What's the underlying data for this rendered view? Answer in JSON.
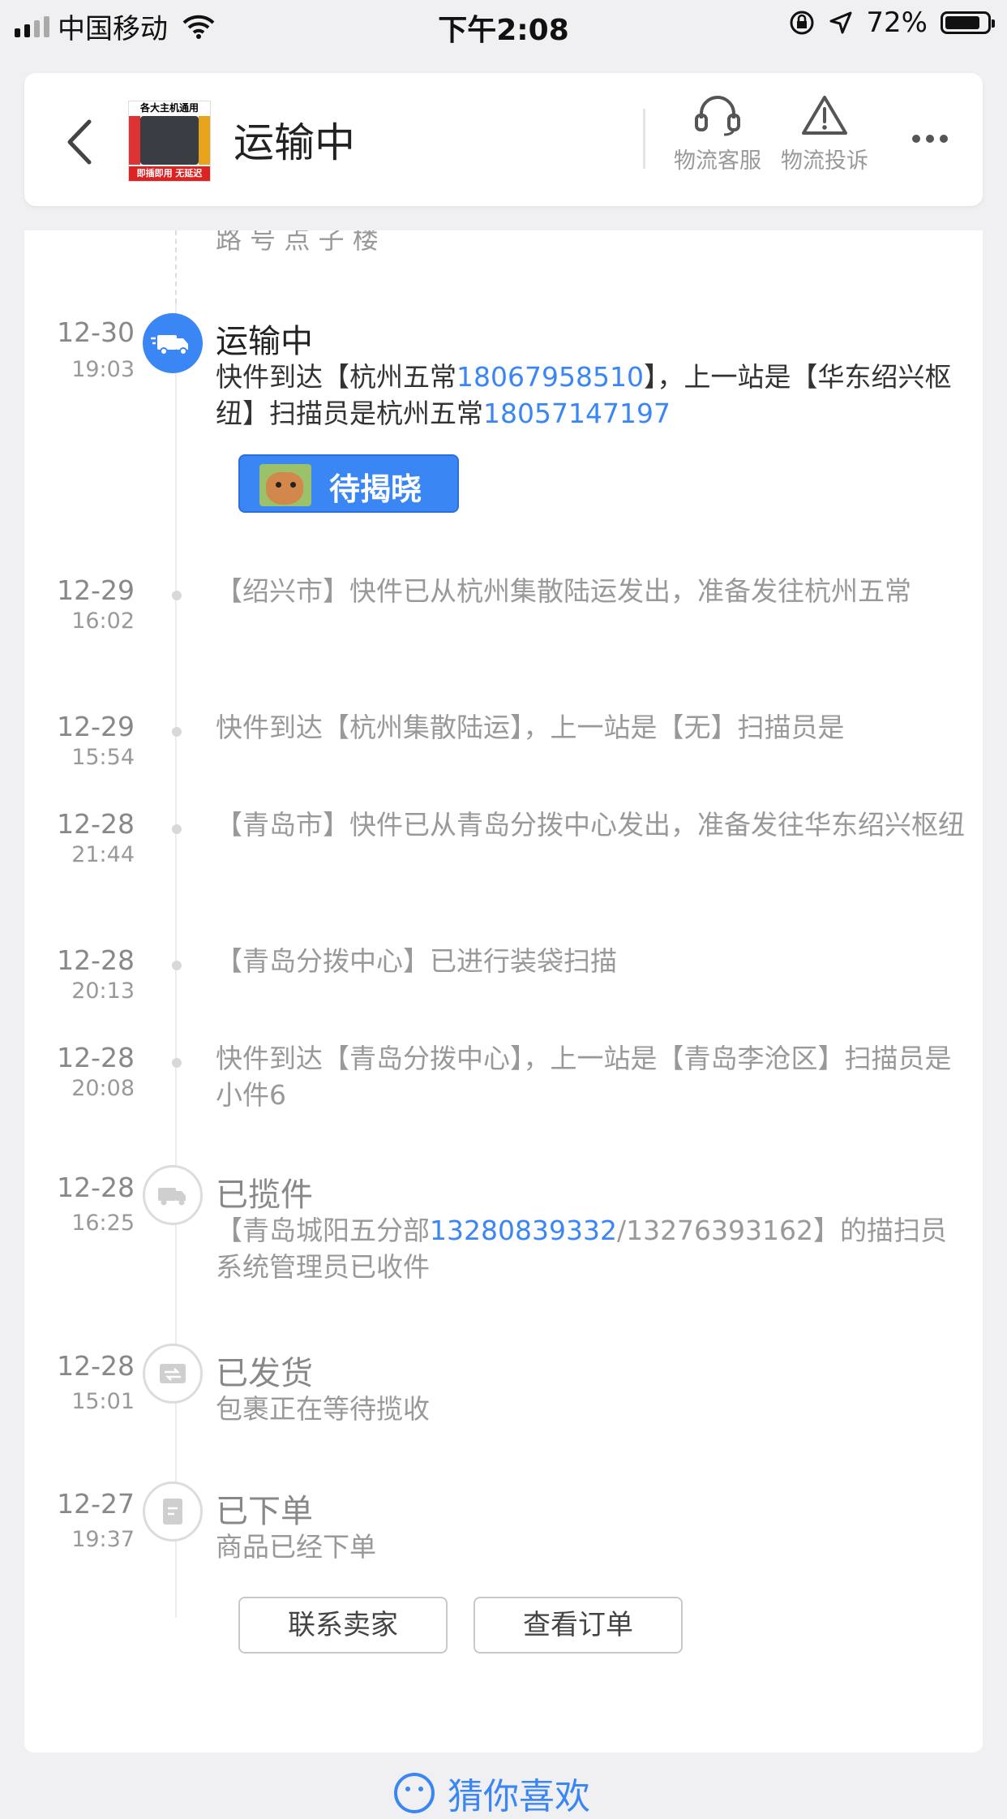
{
  "status_bar": {
    "carrier": "中国移动",
    "time": "下午2:08",
    "battery": "72%"
  },
  "header": {
    "title": "运输中",
    "product_thumb_top": "各大主机通用",
    "product_thumb_bottom": "即插即用 无延迟",
    "service_label": "物流客服",
    "complaint_label": "物流投诉"
  },
  "timeline": {
    "partial_top": "路 号 点 子 楼",
    "events": [
      {
        "date": "12-30",
        "time": "19:03",
        "title": "运输中",
        "text_a": "快件到达【杭州五常",
        "phone_a": "18067958510",
        "text_b": "】，上一站是【华东绍兴枢纽】扫描员是杭州五常",
        "phone_b": "18057147197",
        "badge": "待揭晓"
      },
      {
        "date": "12-29",
        "time": "16:02",
        "text": "【绍兴市】快件已从杭州集散陆运发出，准备发往杭州五常"
      },
      {
        "date": "12-29",
        "time": "15:54",
        "text": "快件到达【杭州集散陆运】，上一站是【无】扫描员是"
      },
      {
        "date": "12-28",
        "time": "21:44",
        "text": "【青岛市】快件已从青岛分拨中心发出，准备发往华东绍兴枢纽"
      },
      {
        "date": "12-28",
        "time": "20:13",
        "text": "【青岛分拨中心】已进行装袋扫描"
      },
      {
        "date": "12-28",
        "time": "20:08",
        "text": "快件到达【青岛分拨中心】，上一站是【青岛李沧区】扫描员是小件6"
      },
      {
        "date": "12-28",
        "time": "16:25",
        "title": "已揽件",
        "text_a": "【青岛城阳五分部",
        "phone_a": "13280839332",
        "text_b": "/13276393162】的描扫员系统管理员已收件"
      },
      {
        "date": "12-28",
        "time": "15:01",
        "title": "已发货",
        "text": "包裹正在等待揽收"
      },
      {
        "date": "12-27",
        "time": "19:37",
        "title": "已下单",
        "text": "商品已经下单"
      }
    ]
  },
  "buttons": {
    "contact_seller": "联系卖家",
    "view_order": "查看订单"
  },
  "footer": {
    "guess_label": "猜你喜欢"
  },
  "colors": {
    "accent": "#3b86f5",
    "background": "#f0f0f2"
  }
}
